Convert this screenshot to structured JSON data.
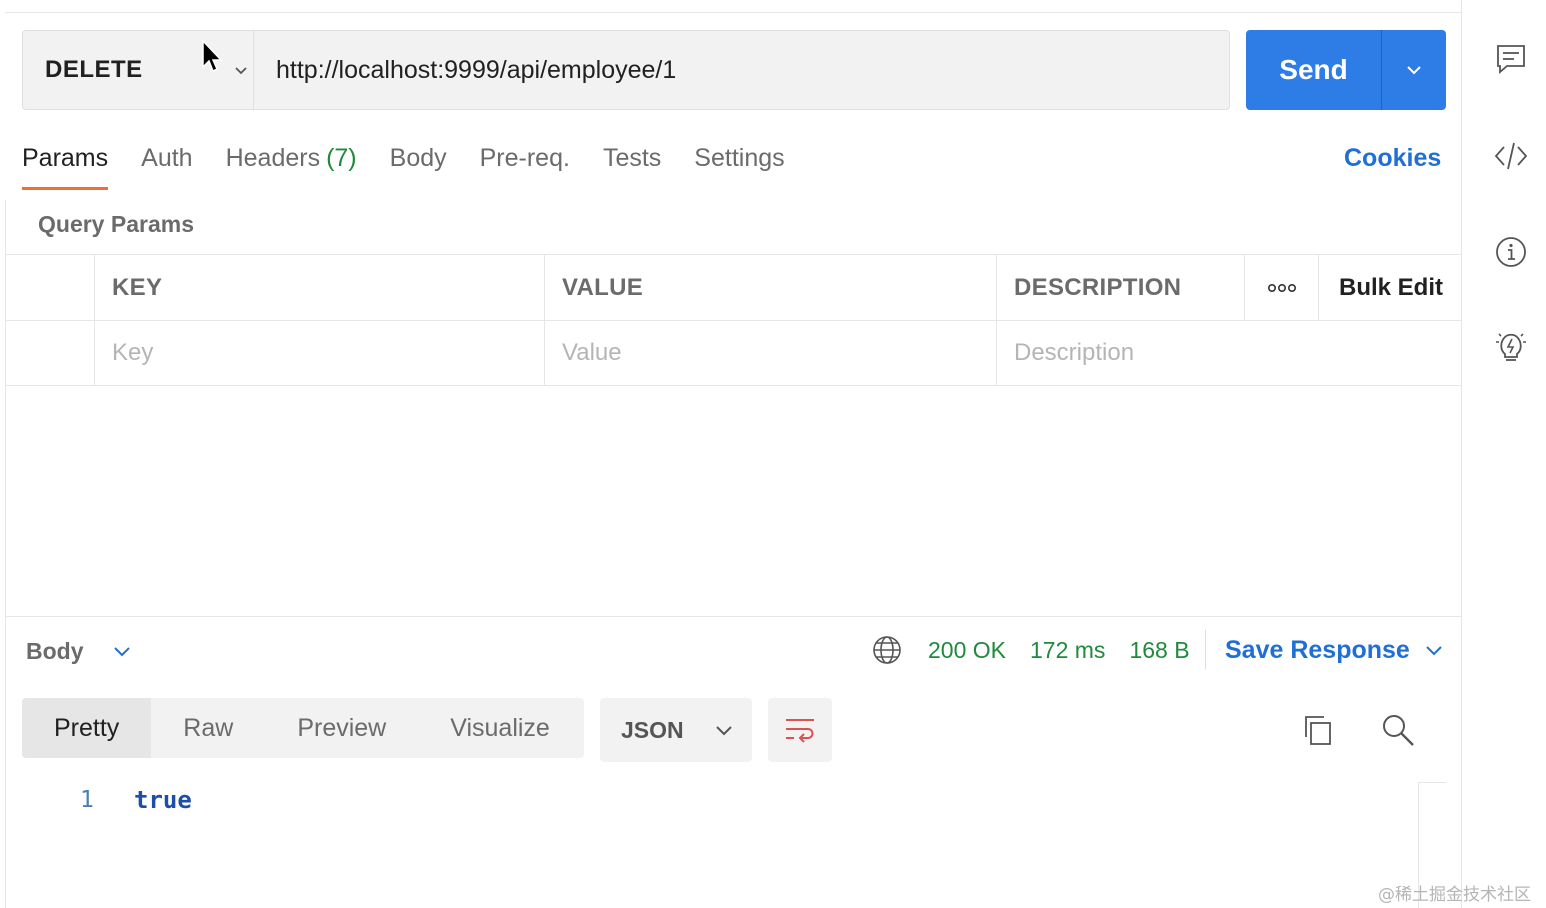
{
  "request": {
    "method": "DELETE",
    "url": "http://localhost:9999/api/employee/1",
    "send_label": "Send"
  },
  "tabs": [
    {
      "label": "Params",
      "active": true
    },
    {
      "label": "Auth"
    },
    {
      "label": "Headers",
      "count": "(7)"
    },
    {
      "label": "Body"
    },
    {
      "label": "Pre-req."
    },
    {
      "label": "Tests"
    },
    {
      "label": "Settings"
    }
  ],
  "cookies_label": "Cookies",
  "query_params": {
    "title": "Query Params",
    "headers": {
      "key": "KEY",
      "value": "VALUE",
      "description": "DESCRIPTION",
      "more": "ooo",
      "bulk_edit": "Bulk Edit"
    },
    "placeholders": {
      "key": "Key",
      "value": "Value",
      "description": "Description"
    }
  },
  "response": {
    "section_label": "Body",
    "status": "200 OK",
    "time": "172 ms",
    "size": "168 B",
    "save_label": "Save Response",
    "formats": [
      "Pretty",
      "Raw",
      "Preview",
      "Visualize"
    ],
    "active_format": "Pretty",
    "language": "JSON",
    "lines": [
      {
        "number": "1",
        "content": "true"
      }
    ]
  },
  "colors": {
    "accent": "#2e7de6",
    "tab_underline": "#f26b3a",
    "status_ok": "#1f8a3b",
    "link": "#1f6fd6"
  },
  "sidebar_icons": [
    "comments-icon",
    "code-icon",
    "info-icon",
    "lightbulb-icon"
  ],
  "watermark": "@稀土掘金技术社区"
}
